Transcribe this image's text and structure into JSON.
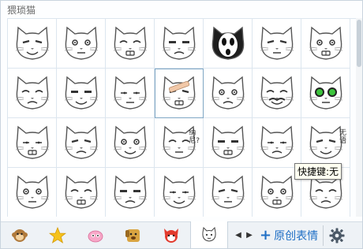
{
  "title": "猥琐猫",
  "tooltip": "快捷键:无",
  "grid": {
    "rows": 4,
    "columns": 7,
    "selected": {
      "row": 2,
      "column": 4
    }
  },
  "faces": [
    "grinning-cat-face",
    "smiling-cat-face",
    "sneering-cat-face",
    "grinning-cat-face",
    "black-mask-face",
    "smirking-cat-face",
    "laughing-cat-face",
    "sleepy-cat-face",
    "shocked-cat-face",
    "squinting-cat-face",
    "bandaged-cat-face",
    "bored-cat-face",
    "mustache-cat-face",
    "goggles-cat-face",
    "crying-cat-face",
    "dizzy-cat-face",
    "weeping-cat-face",
    "sly-cat-face",
    "worried-cat-face",
    "buck-teeth-cat-face",
    "sad-cat-face",
    "scribble-cat-face",
    "annoyed-cat-face",
    "spiral-eyes-cat-face",
    "questioning-cat-face",
    "tearful-cat-face",
    "pig-nose-cat-face",
    "speechless-cat-face"
  ],
  "captions": {
    "cell_row3_col4": "纳\n尼?",
    "cell_row3_col7": "无\n语"
  },
  "toolbar": {
    "packs": [
      {
        "icon": "monkey-icon",
        "active": false
      },
      {
        "icon": "star-icon",
        "active": false
      },
      {
        "icon": "pink-blob-icon",
        "active": false
      },
      {
        "icon": "dog-icon",
        "active": false
      },
      {
        "icon": "red-fox-icon",
        "active": false
      },
      {
        "icon": "cat-face-icon",
        "active": true
      }
    ],
    "prev_label": "◀",
    "next_label": "▶",
    "add_label": "原创表情",
    "add_symbol": "+"
  },
  "colors": {
    "accent": "#1f6fc5",
    "grid_line": "#dce6ef",
    "tooltip_bg": "#fffff1"
  }
}
